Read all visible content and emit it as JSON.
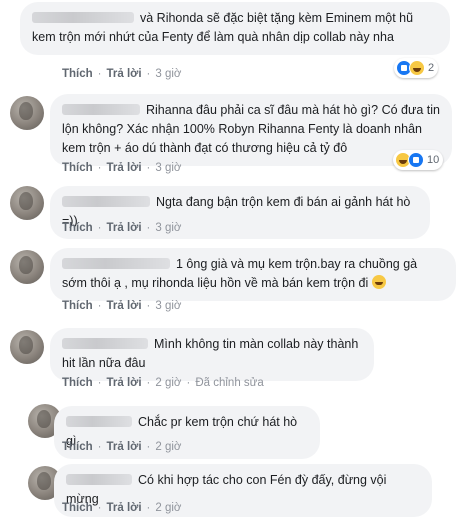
{
  "actions": {
    "like": "Thích",
    "reply": "Trả lời",
    "sep": "·"
  },
  "comments": [
    {
      "text": "và Rihonda sẽ đặc biệt tặng kèm Eminem một hũ kem trộn mới nhứt của Fenty để làm quà nhân dịp collab này nha",
      "time": "3 giờ",
      "reactions": [
        "like-icon",
        "haha-icon"
      ],
      "reaction_count": "2"
    },
    {
      "text": "Rihanna đâu phải ca sĩ đâu mà hát hò gì? Có đưa tin lộn không? Xác nhận 100% Robyn Rihanna Fenty là doanh nhân kem trộn + áo dú thành đạt có thương hiệu cả tỷ đô",
      "time": "3 giờ",
      "reactions": [
        "haha-icon",
        "like-icon"
      ],
      "reaction_count": "10"
    },
    {
      "text": "Ngta đang bận trộn kem đi bán ai gảnh hát hò =))",
      "time": "3 giờ"
    },
    {
      "text": "1 ông già và mụ kem trộn.bay ra chuồng gà sớm thôi ạ , mụ rihonda liệu hồn về mà bán kem trộn đi",
      "emoji": "grin-face",
      "time": "3 giờ"
    },
    {
      "text": "Mình không tin màn collab này thành hit lần nữa đâu",
      "time": "2 giờ",
      "edited": "Đã chỉnh sửa"
    },
    {
      "text": "Chắc pr kem trộn chứ hát hò gì",
      "time": "2 giờ"
    },
    {
      "text": "Có khi hợp tác cho con Fén đỳ đấy, đừng vội mừng",
      "time": "2 giờ"
    }
  ]
}
